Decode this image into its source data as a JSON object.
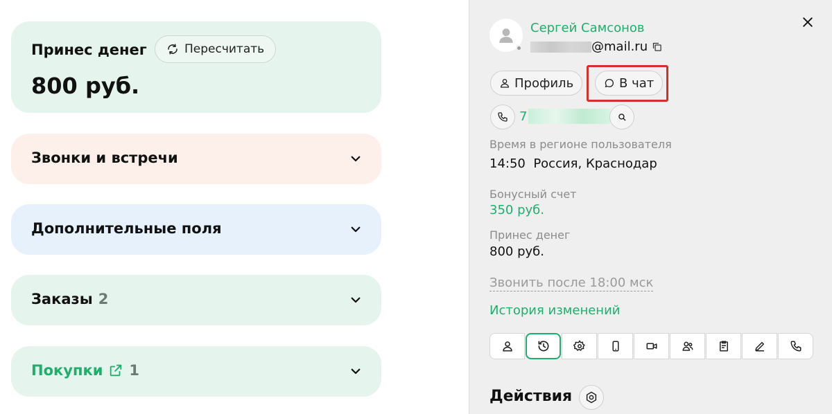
{
  "left": {
    "money": {
      "title": "Принес денег",
      "recalc_label": "Пересчитать",
      "value": "800 руб."
    },
    "calls": {
      "title": "Звонки и встречи"
    },
    "extra": {
      "title": "Дополнительные поля"
    },
    "orders": {
      "title": "Заказы",
      "count": "2"
    },
    "purchases": {
      "title": "Покупки",
      "count": "1"
    }
  },
  "panel": {
    "user_name": "Сергей Самсонов",
    "email_domain": "@mail.ru",
    "profile_label": "Профиль",
    "chat_label": "В чат",
    "phone_prefix": "7",
    "time_label": "Время в регионе пользователя",
    "time_value": "14:50  Россия, Краснодар",
    "bonus_label": "Бонусный счет",
    "bonus_value": "350 руб.",
    "money_label": "Принес денег",
    "money_value": "800 руб.",
    "call_after": "Звонить после 18:00 мск",
    "history_link": "История изменений",
    "actions_title": "Действия",
    "tabs": [
      "user-icon",
      "history-icon",
      "settings-icon",
      "mobile-icon",
      "video-icon",
      "users-icon",
      "clipboard-icon",
      "pencil-icon",
      "phone-icon"
    ],
    "active_tab": 1
  },
  "colors": {
    "accent_green": "#1fae6c",
    "highlight_red": "#d92c2c"
  }
}
